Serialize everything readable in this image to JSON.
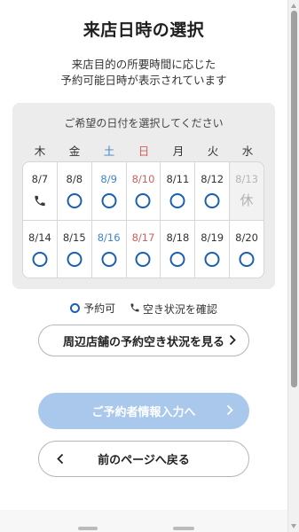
{
  "page": {
    "title": "来店日時の選択",
    "subtitle_line1": "来店目的の所要時間に応じた",
    "subtitle_line2": "予約可能日時が表示されています"
  },
  "calendar": {
    "caption": "ご希望の日付を選択してください",
    "weekdays": [
      "木",
      "金",
      "土",
      "日",
      "月",
      "火",
      "水"
    ],
    "weekday_colors": [
      "#333333",
      "#333333",
      "#3f86c8",
      "#d0605f",
      "#333333",
      "#333333",
      "#333333"
    ],
    "weeks": [
      [
        {
          "date": "8/7",
          "status": "phone"
        },
        {
          "date": "8/8",
          "status": "available"
        },
        {
          "date": "8/9",
          "status": "available"
        },
        {
          "date": "8/10",
          "status": "available"
        },
        {
          "date": "8/11",
          "status": "available"
        },
        {
          "date": "8/12",
          "status": "available"
        },
        {
          "date": "8/13",
          "status": "closed",
          "label": "休"
        }
      ],
      [
        {
          "date": "8/14",
          "status": "available"
        },
        {
          "date": "8/15",
          "status": "available"
        },
        {
          "date": "8/16",
          "status": "available"
        },
        {
          "date": "8/17",
          "status": "available"
        },
        {
          "date": "8/18",
          "status": "available"
        },
        {
          "date": "8/19",
          "status": "available"
        },
        {
          "date": "8/20",
          "status": "available"
        }
      ]
    ]
  },
  "legend": {
    "available_label": "予約可",
    "phone_label": "空き状況を確認"
  },
  "buttons": {
    "nearby_label": "周辺店舗の予約空き状況を見る",
    "next_label": "ご予約者情報入力へ",
    "back_label": "前のページへ戻る"
  },
  "colors": {
    "accent": "#1b5fb0",
    "saturday": "#3f86c8",
    "sunday": "#d0605f",
    "disabled_button": "#aac8ec"
  },
  "icons": {
    "available": "circle-icon",
    "phone": "phone-icon",
    "chevron_right": "chevron-right-icon",
    "chevron_left": "chevron-left-icon"
  }
}
